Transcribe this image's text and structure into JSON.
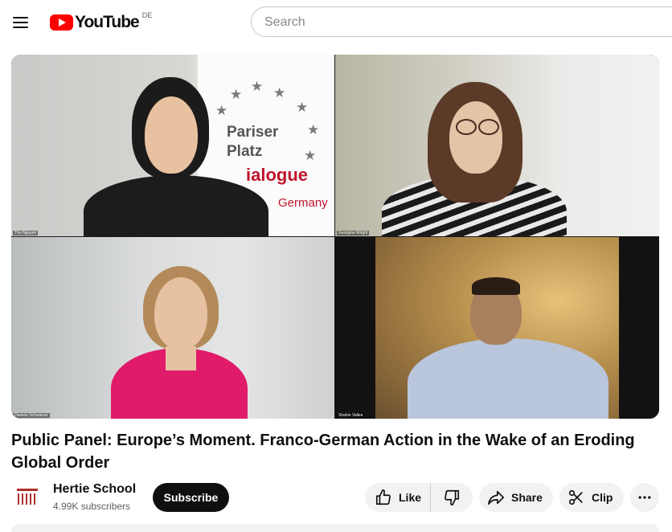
{
  "header": {
    "logo_text": "YouTube",
    "country_code": "DE",
    "search_placeholder": "Search"
  },
  "video": {
    "participants": [
      {
        "name": "Thu Nguyen"
      },
      {
        "name": "Georgina Wright"
      },
      {
        "name": "Daniela Schwarzer"
      },
      {
        "name": "Shahin Vallee"
      }
    ],
    "banner": {
      "line1": "Pariser",
      "line2": "Platz",
      "line3": "ialogue",
      "line4": "Germany"
    }
  },
  "title": "Public Panel: Europe’s Moment. Franco-German Action in the Wake of an Eroding Global Order",
  "channel": {
    "name": "Hertie School",
    "subscribers": "4.99K subscribers",
    "subscribe_label": "Subscribe"
  },
  "actions": {
    "like_label": "Like",
    "share_label": "Share",
    "clip_label": "Clip"
  },
  "icons": {
    "menu": "hamburger-icon",
    "like": "thumbs-up-icon",
    "dislike": "thumbs-down-icon",
    "share": "share-arrow-icon",
    "clip": "scissors-icon",
    "more": "more-horizontal-icon"
  },
  "colors": {
    "brand_red": "#ff0000",
    "subscribe_bg": "#0f0f0f",
    "pill_bg": "#f2f2f2"
  }
}
